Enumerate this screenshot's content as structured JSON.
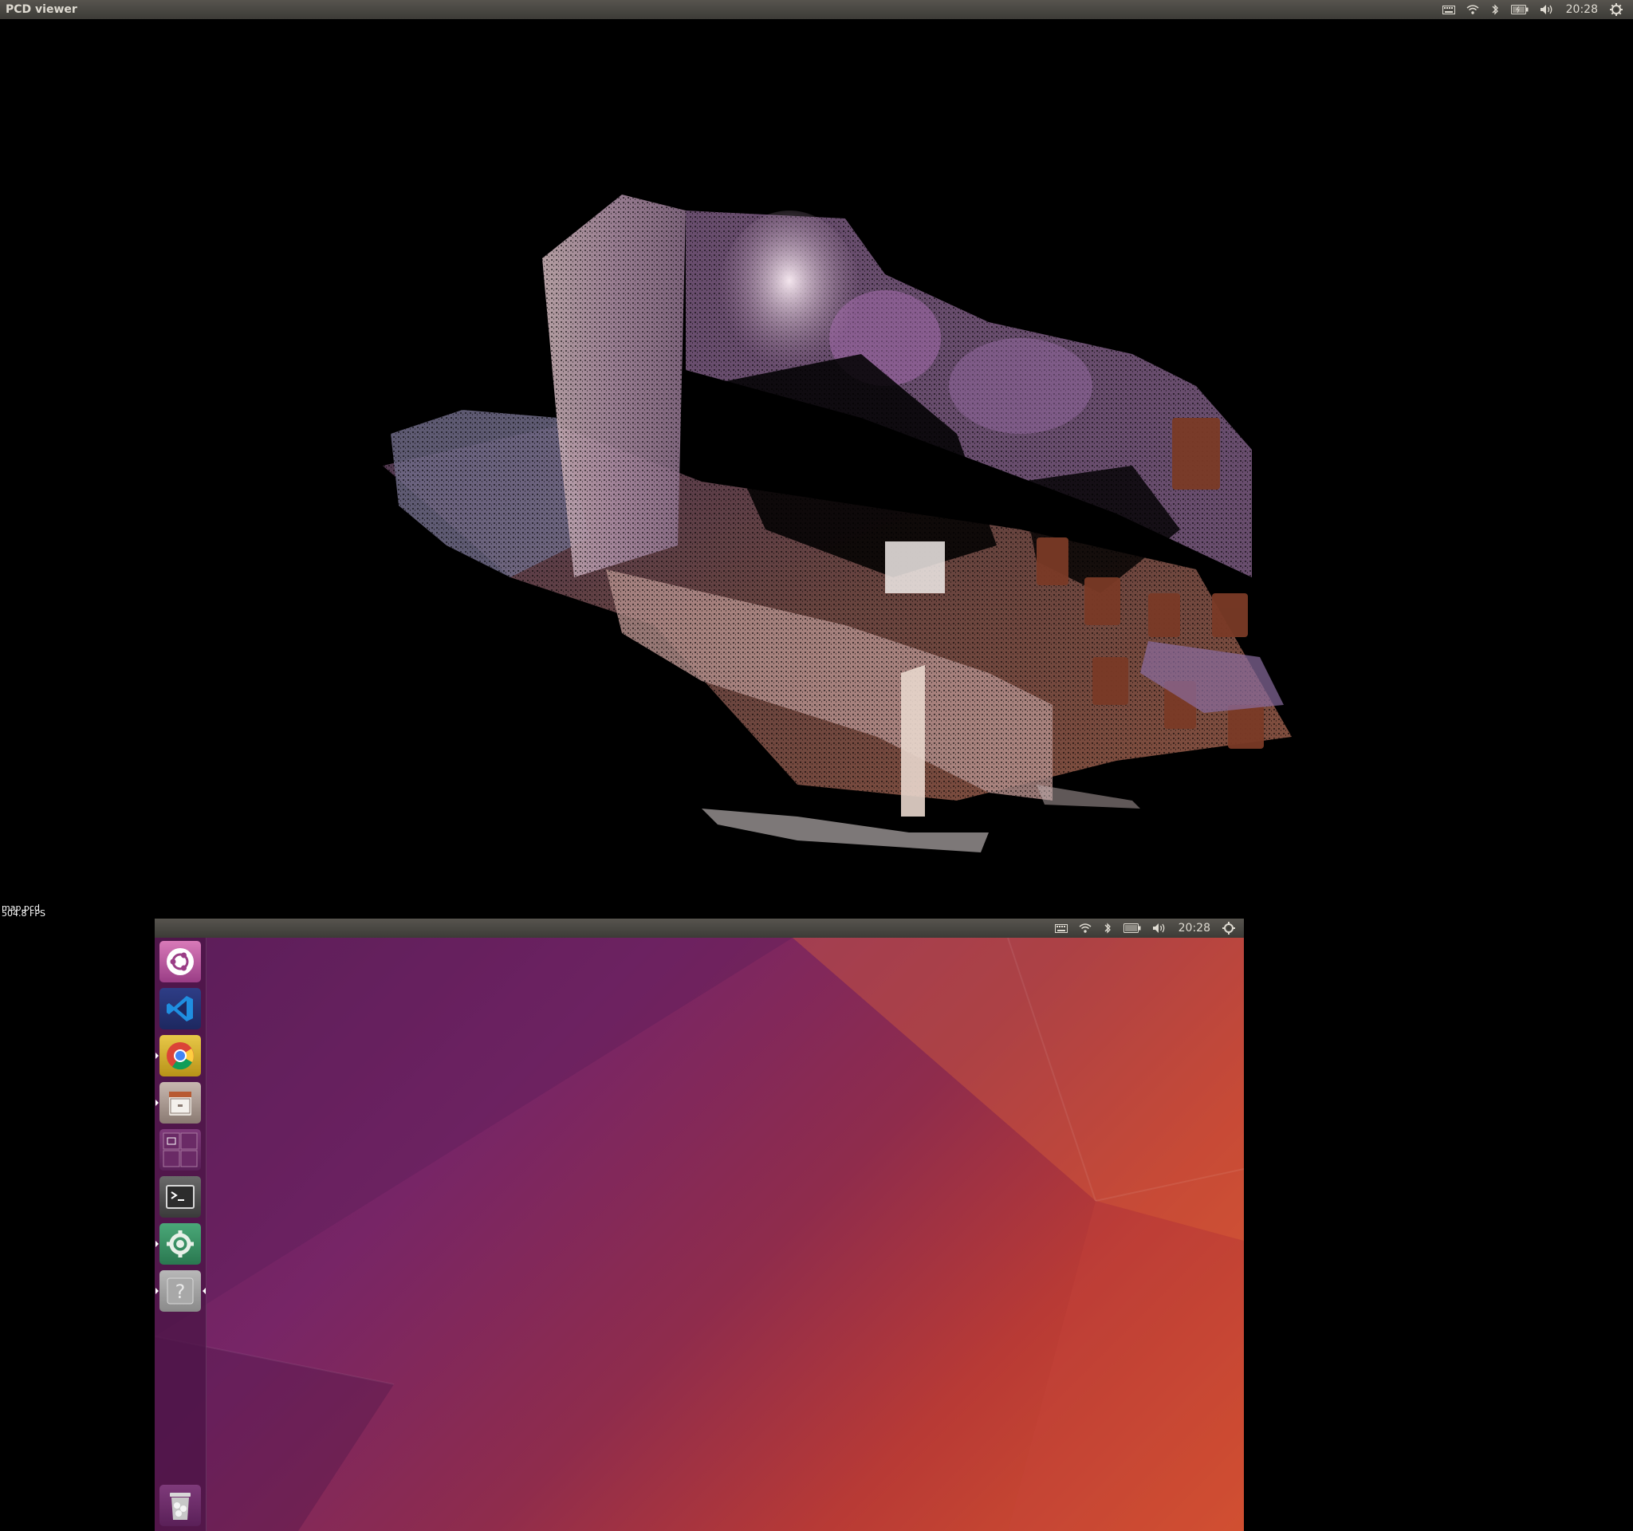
{
  "topbar": {
    "title": "PCD viewer",
    "clock": "20:28"
  },
  "viewer": {
    "filename": "map.pcd",
    "fps": "504.8 FPS"
  },
  "desktop_topbar": {
    "clock": "20:28"
  },
  "launcher": {
    "items": [
      {
        "name": "ubuntu-dash"
      },
      {
        "name": "visual-studio-code"
      },
      {
        "name": "google-chrome"
      },
      {
        "name": "files"
      },
      {
        "name": "workspace-switcher"
      },
      {
        "name": "terminal"
      },
      {
        "name": "settings"
      },
      {
        "name": "unknown-app"
      }
    ],
    "trash": "trash"
  },
  "colors": {
    "panel": "#3c3b37",
    "panel_text": "#dfdbd2",
    "launcher": "#4b1446",
    "wallpaper_start": "#5e1f5a",
    "wallpaper_end": "#d6542d"
  }
}
